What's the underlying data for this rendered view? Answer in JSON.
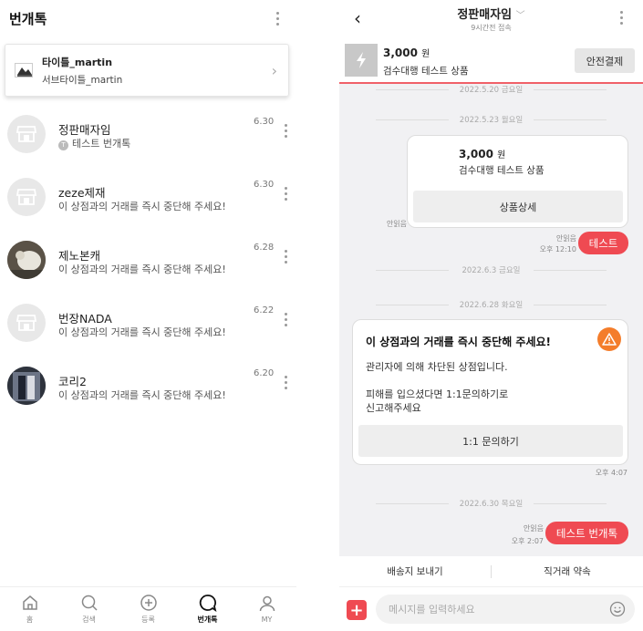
{
  "left": {
    "title": "번개톡",
    "pinned": {
      "title": "타이틀_martin",
      "subtitle": "서브타이틀_martin"
    },
    "chats": [
      {
        "name": "정판매자임",
        "badge": "T",
        "message": "테스트 번개톡",
        "date": "6.30",
        "avatar": "store-icon"
      },
      {
        "name": "zeze제재",
        "message": "이 상점과의 거래를 즉시 중단해 주세요!",
        "date": "6.30",
        "avatar": "store-icon"
      },
      {
        "name": "제노본캐",
        "message": "이 상점과의 거래를 즉시 중단해 주세요!",
        "date": "6.28",
        "avatar": "photo"
      },
      {
        "name": "번장NADA",
        "message": "이 상점과의 거래를 즉시 중단해 주세요!",
        "date": "6.22",
        "avatar": "store-icon"
      },
      {
        "name": "코리2",
        "message": "이 상점과의 거래를 즉시 중단해 주세요!",
        "date": "6.20",
        "avatar": "photo"
      }
    ],
    "nav": [
      {
        "label": "홈",
        "icon": "home-icon"
      },
      {
        "label": "검색",
        "icon": "search-icon"
      },
      {
        "label": "등록",
        "icon": "plus-circle-icon"
      },
      {
        "label": "번개톡",
        "icon": "chat-icon",
        "active": true
      },
      {
        "label": "MY",
        "icon": "user-icon"
      }
    ]
  },
  "right": {
    "title": "정판매자임",
    "seen": "9시간전 접속",
    "product": {
      "price": "3,000",
      "unit": "원",
      "name": "검수대행 테스트 상품",
      "safe_pay": "안전결제"
    },
    "dates": [
      "2022.5.20 금요일",
      "2022.5.23 월요일",
      "2022.6.3 금요일",
      "2022.6.28 화요일",
      "2022.6.30 목요일"
    ],
    "product_card": {
      "price": "3,000",
      "unit": "원",
      "name": "검수대행 테스트 상품",
      "button": "상품상세",
      "read": "안읽음"
    },
    "msg1": {
      "read": "안읽음",
      "time": "오후 12:10",
      "text": "테스트"
    },
    "warning": {
      "title": "이 상점과의 거래를 즉시 중단해 주세요!",
      "body": "관리자에 의해 차단된 상점입니다.\n\n피해를 입으셨다면 1:1문의하기로\n신고해주세요",
      "button": "1:1 문의하기",
      "time": "오후 4:07"
    },
    "msg2": {
      "read": "안읽음",
      "time": "오후 2:07",
      "text": "테스트 번개톡"
    },
    "quick": [
      "배송지 보내기",
      "직거래 약속"
    ],
    "input_placeholder": "메시지를 입력하세요",
    "accent": "#ef4a52",
    "warning_color": "#f47d2b"
  }
}
